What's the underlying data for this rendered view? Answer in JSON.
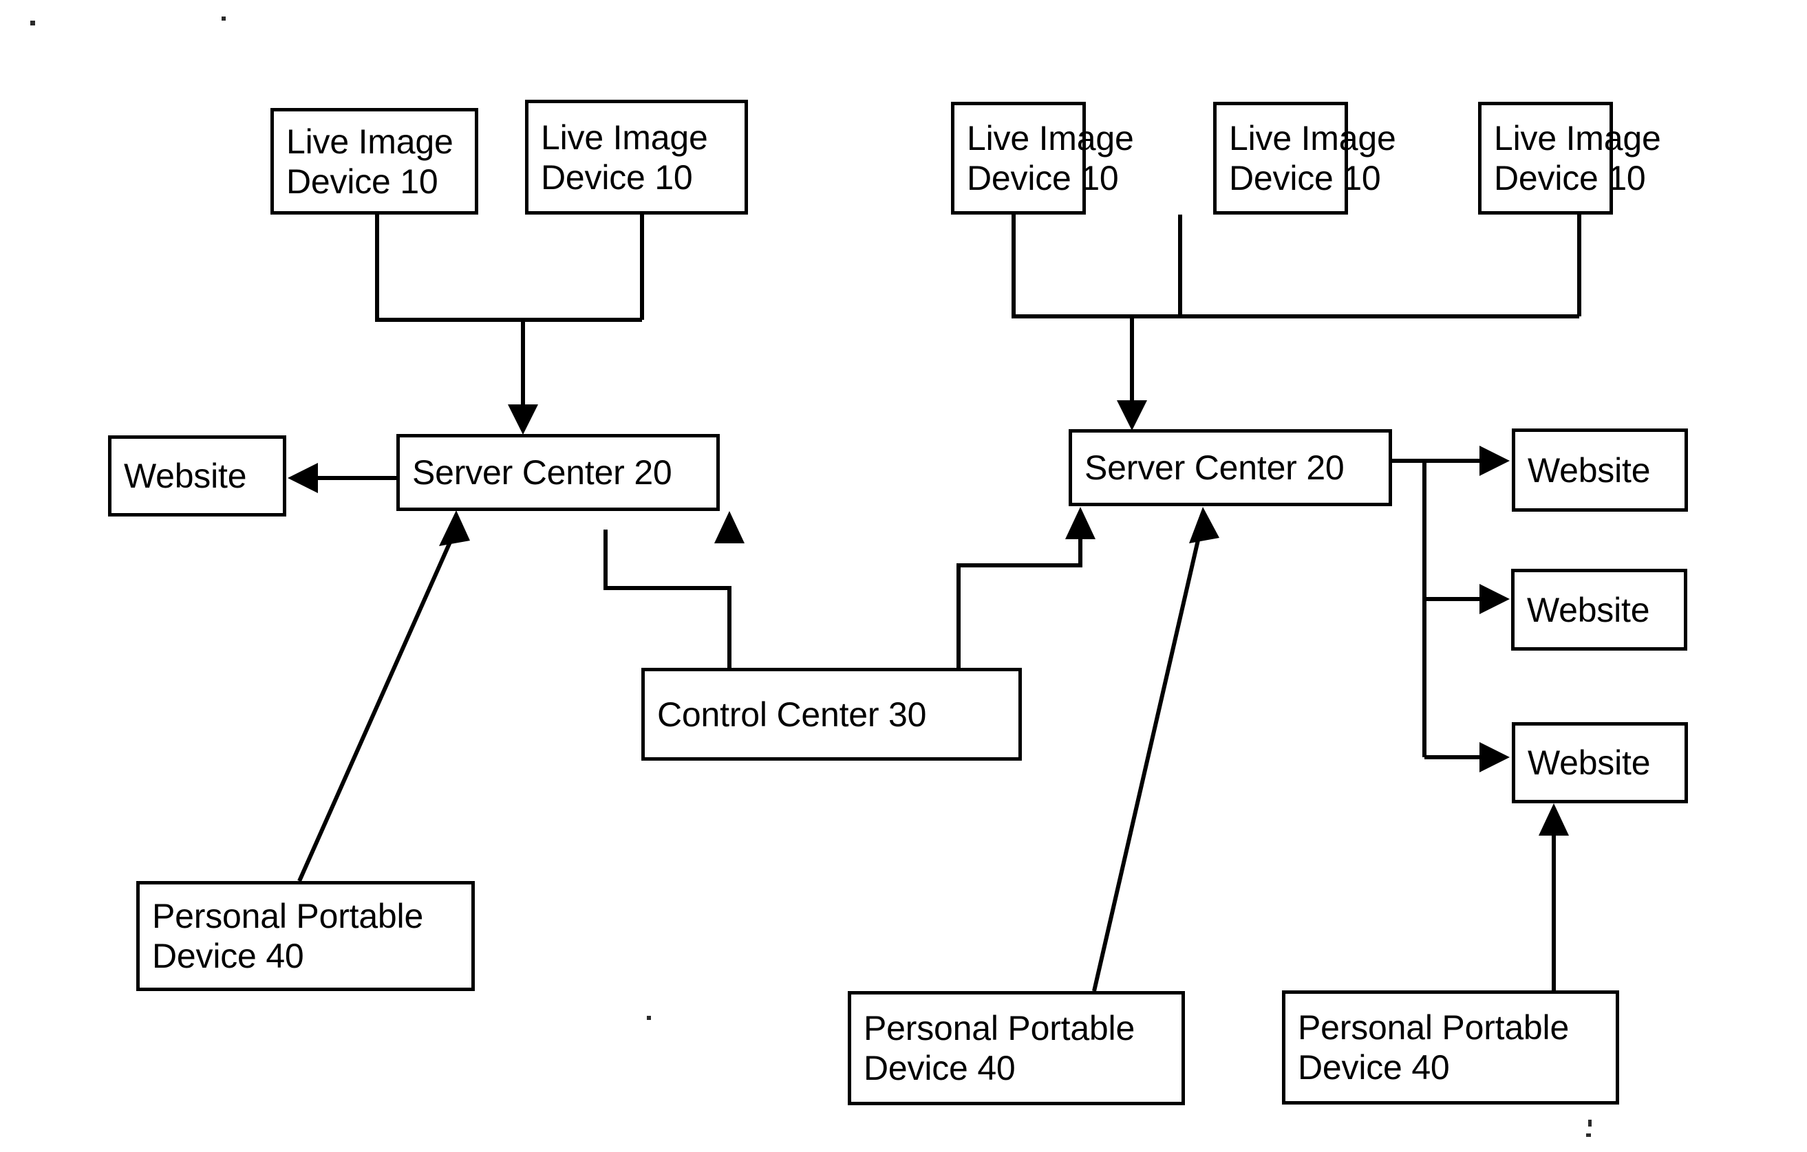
{
  "figure": {
    "title": "System architecture block diagram",
    "background_color": "#ffffff",
    "stroke_color": "#000000"
  },
  "nodes": {
    "left_cluster": {
      "live_image_device_1": {
        "line1": "Live Image",
        "line2": "Device 10"
      },
      "live_image_device_2": {
        "line1": "Live Image",
        "line2": "Device 10"
      },
      "server_center": {
        "line1": "Server Center 20"
      },
      "website": {
        "line1": "Website"
      },
      "personal_portable_device": {
        "line1": "Personal Portable",
        "line2": "Device 40"
      }
    },
    "control_center": {
      "line1": "Control Center 30"
    },
    "right_cluster": {
      "live_image_device_1": {
        "line1": "Live Image",
        "line2": "Device 10"
      },
      "live_image_device_2": {
        "line1": "Live Image",
        "line2": "Device 10"
      },
      "live_image_device_3": {
        "line1": "Live Image",
        "line2": "Device 10"
      },
      "server_center": {
        "line1": "Server Center 20"
      },
      "website_1": {
        "line1": "Website"
      },
      "website_2": {
        "line1": "Website"
      },
      "website_3": {
        "line1": "Website"
      },
      "personal_portable_device_1": {
        "line1": "Personal Portable",
        "line2": "Device 40"
      },
      "personal_portable_device_2": {
        "line1": "Personal Portable",
        "line2": "Device 40"
      }
    }
  },
  "connections": [
    {
      "from": "left live image device 1",
      "to": "left server center",
      "style": "orthogonal-bus-arrow"
    },
    {
      "from": "left live image device 2",
      "to": "left server center",
      "style": "orthogonal-bus-arrow"
    },
    {
      "from": "left server center",
      "to": "left website",
      "style": "horizontal-arrow"
    },
    {
      "from": "left personal portable device 40",
      "to": "left server center",
      "style": "diagonal-arrow"
    },
    {
      "from": "control center 30",
      "to": "left server center",
      "style": "orthogonal-step-arrow"
    },
    {
      "from": "control center 30",
      "to": "right server center",
      "style": "orthogonal-step-arrow"
    },
    {
      "from": "right live image device 1",
      "to": "right server center",
      "style": "orthogonal-bus-arrow"
    },
    {
      "from": "right live image device 2",
      "to": "right server center",
      "style": "orthogonal-bus-arrow"
    },
    {
      "from": "right live image device 3",
      "to": "right server center",
      "style": "orthogonal-bus-arrow"
    },
    {
      "from": "right server center",
      "to": "right website 1",
      "style": "orthogonal-branch-arrow"
    },
    {
      "from": "right server center",
      "to": "right website 2",
      "style": "orthogonal-branch-arrow"
    },
    {
      "from": "right server center",
      "to": "right website 3",
      "style": "orthogonal-branch-arrow"
    },
    {
      "from": "middle personal portable device 40",
      "to": "right server center",
      "style": "diagonal-arrow"
    },
    {
      "from": "right personal portable device 40",
      "to": "right website 3",
      "style": "vertical-arrow"
    }
  ]
}
